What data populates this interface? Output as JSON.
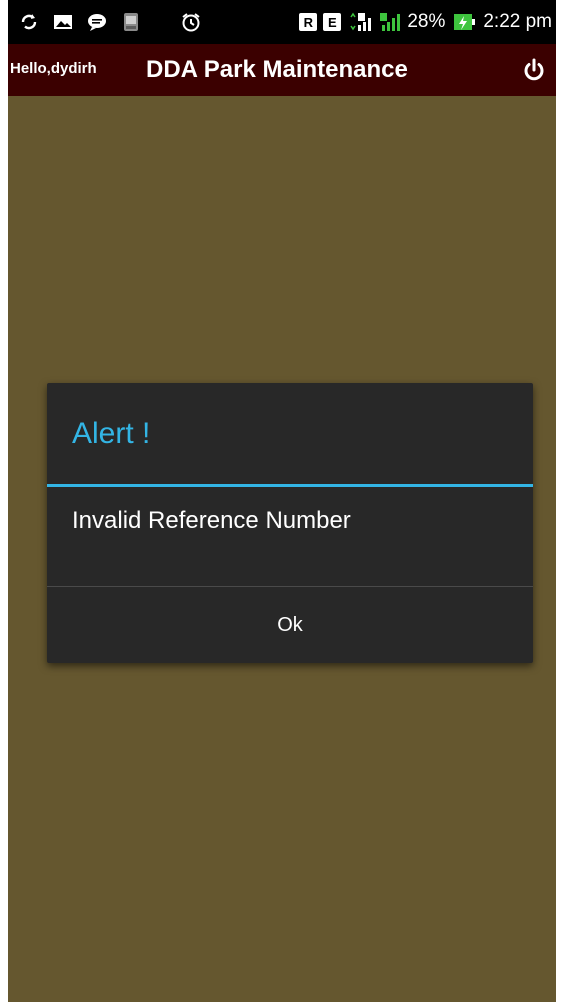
{
  "status_bar": {
    "icons": [
      "sync-icon",
      "image-icon",
      "message-icon",
      "app-icon",
      "alarm-icon",
      "r-badge-icon",
      "e-badge-icon",
      "signal-1-icon",
      "signal-2-icon",
      "battery-charging-icon"
    ],
    "badge_r": "R",
    "badge_e": "E",
    "battery": "28%",
    "time": "2:22 pm"
  },
  "action_bar": {
    "greeting": "Hello,dydirh",
    "title": "DDA Park Maintenance",
    "power_icon": "power-icon",
    "background": "#3b0000"
  },
  "screen": {
    "background": "#65572f"
  },
  "dialog": {
    "title": "Alert !",
    "message": "Invalid Reference Number",
    "ok_label": "Ok",
    "accent": "#33b5e5"
  }
}
